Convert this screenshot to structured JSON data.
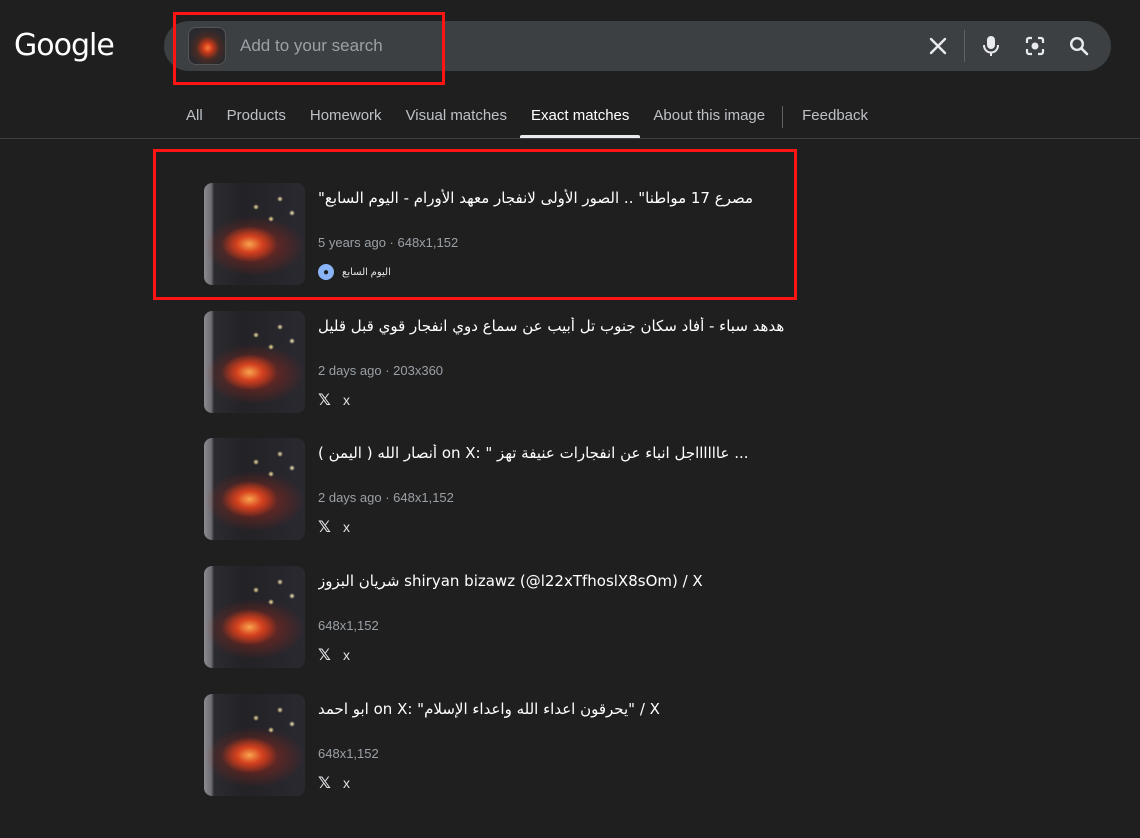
{
  "header": {
    "logo": "Google",
    "search": {
      "placeholder": "Add to your search",
      "value": ""
    }
  },
  "tabs": [
    {
      "label": "All"
    },
    {
      "label": "Products"
    },
    {
      "label": "Homework"
    },
    {
      "label": "Visual matches"
    },
    {
      "label": "Exact matches",
      "active": true
    },
    {
      "label": "About this image"
    },
    {
      "label": "Feedback"
    }
  ],
  "results": [
    {
      "title": "\"مصرع 17 مواطنا\" .. الصور الأولى لانفجار معهد الأورام - اليوم السابع",
      "meta": "5 years ago · 648x1,152",
      "source": "اليوم السابع",
      "source_icon": "globe-icon"
    },
    {
      "title": "هدهد سباء - أفاد سكان جنوب تل أبيب عن سماع دوي انفجار قوي قبل قليل - X",
      "meta": "2 days ago · 203x360",
      "source": "x",
      "source_icon": "x-logo-icon"
    },
    {
      "title": "أنصار الله ( اليمن ) on X: \" عااااااجل انباء عن انفجارات عنيفة تهز ...",
      "meta": "2 days ago · 648x1,152",
      "source": "x",
      "source_icon": "x-logo-icon"
    },
    {
      "title": "شريان البزوز shiryan bizawz (@l22xTfhoslX8sOm) / X",
      "meta": "648x1,152",
      "source": "x",
      "source_icon": "x-logo-icon"
    },
    {
      "title": "ابو احمد on X: \"يحرقون اعداء الله واعداء الإسلام\" / X",
      "meta": "648x1,152",
      "source": "x",
      "source_icon": "x-logo-icon"
    }
  ],
  "colors": {
    "background": "#1f1f1f",
    "searchbar": "#3c4043",
    "annotation": "#ff1414",
    "text_primary": "#ffffff",
    "text_secondary": "#9aa0a6"
  }
}
